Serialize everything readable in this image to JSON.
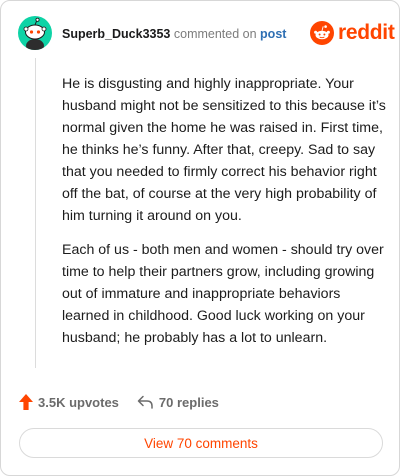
{
  "header": {
    "username": "Superb_Duck3353",
    "action_text": "commented on",
    "post_link": "post",
    "brand_name": "reddit",
    "brand_color": "#ff4500",
    "avatar_color": "#0ed3a6",
    "avatar_icon": "snoo-avatar-icon"
  },
  "comment": {
    "paragraphs": [
      "He is disgusting and highly inappropriate. Your husband might not be sensitized to this because it’s normal given the home he was raised in. First time, he thinks he’s funny. After that, creepy. Sad to say that you needed to firmly correct his behavior right off the bat, of course at the very high probability of him turning it around on you.",
      "Each of us - both men and women - should try over time to help their partners grow, including growing out of immature and inappropriate behaviors learned in childhood. Good luck working on your husband; he probably has a lot to unlearn."
    ]
  },
  "stats": {
    "upvotes": "3.5K upvotes",
    "upvote_icon": "upvote-arrow-icon",
    "replies": "70 replies",
    "reply_icon": "reply-arrow-icon"
  },
  "footer": {
    "view_comments_label": "View 70 comments"
  }
}
